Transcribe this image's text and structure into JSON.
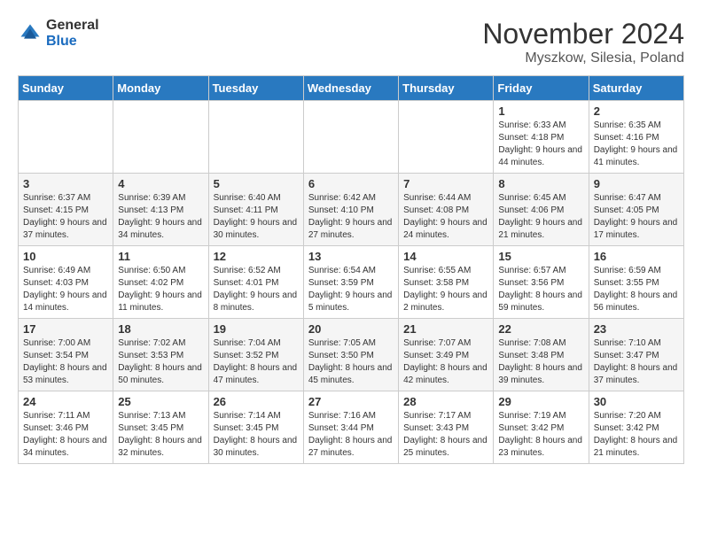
{
  "header": {
    "logo_general": "General",
    "logo_blue": "Blue",
    "month_year": "November 2024",
    "location": "Myszkow, Silesia, Poland"
  },
  "days_of_week": [
    "Sunday",
    "Monday",
    "Tuesday",
    "Wednesday",
    "Thursday",
    "Friday",
    "Saturday"
  ],
  "weeks": [
    [
      {
        "day": "",
        "info": ""
      },
      {
        "day": "",
        "info": ""
      },
      {
        "day": "",
        "info": ""
      },
      {
        "day": "",
        "info": ""
      },
      {
        "day": "",
        "info": ""
      },
      {
        "day": "1",
        "info": "Sunrise: 6:33 AM\nSunset: 4:18 PM\nDaylight: 9 hours\nand 44 minutes."
      },
      {
        "day": "2",
        "info": "Sunrise: 6:35 AM\nSunset: 4:16 PM\nDaylight: 9 hours\nand 41 minutes."
      }
    ],
    [
      {
        "day": "3",
        "info": "Sunrise: 6:37 AM\nSunset: 4:15 PM\nDaylight: 9 hours\nand 37 minutes."
      },
      {
        "day": "4",
        "info": "Sunrise: 6:39 AM\nSunset: 4:13 PM\nDaylight: 9 hours\nand 34 minutes."
      },
      {
        "day": "5",
        "info": "Sunrise: 6:40 AM\nSunset: 4:11 PM\nDaylight: 9 hours\nand 30 minutes."
      },
      {
        "day": "6",
        "info": "Sunrise: 6:42 AM\nSunset: 4:10 PM\nDaylight: 9 hours\nand 27 minutes."
      },
      {
        "day": "7",
        "info": "Sunrise: 6:44 AM\nSunset: 4:08 PM\nDaylight: 9 hours\nand 24 minutes."
      },
      {
        "day": "8",
        "info": "Sunrise: 6:45 AM\nSunset: 4:06 PM\nDaylight: 9 hours\nand 21 minutes."
      },
      {
        "day": "9",
        "info": "Sunrise: 6:47 AM\nSunset: 4:05 PM\nDaylight: 9 hours\nand 17 minutes."
      }
    ],
    [
      {
        "day": "10",
        "info": "Sunrise: 6:49 AM\nSunset: 4:03 PM\nDaylight: 9 hours\nand 14 minutes."
      },
      {
        "day": "11",
        "info": "Sunrise: 6:50 AM\nSunset: 4:02 PM\nDaylight: 9 hours\nand 11 minutes."
      },
      {
        "day": "12",
        "info": "Sunrise: 6:52 AM\nSunset: 4:01 PM\nDaylight: 9 hours\nand 8 minutes."
      },
      {
        "day": "13",
        "info": "Sunrise: 6:54 AM\nSunset: 3:59 PM\nDaylight: 9 hours\nand 5 minutes."
      },
      {
        "day": "14",
        "info": "Sunrise: 6:55 AM\nSunset: 3:58 PM\nDaylight: 9 hours\nand 2 minutes."
      },
      {
        "day": "15",
        "info": "Sunrise: 6:57 AM\nSunset: 3:56 PM\nDaylight: 8 hours\nand 59 minutes."
      },
      {
        "day": "16",
        "info": "Sunrise: 6:59 AM\nSunset: 3:55 PM\nDaylight: 8 hours\nand 56 minutes."
      }
    ],
    [
      {
        "day": "17",
        "info": "Sunrise: 7:00 AM\nSunset: 3:54 PM\nDaylight: 8 hours\nand 53 minutes."
      },
      {
        "day": "18",
        "info": "Sunrise: 7:02 AM\nSunset: 3:53 PM\nDaylight: 8 hours\nand 50 minutes."
      },
      {
        "day": "19",
        "info": "Sunrise: 7:04 AM\nSunset: 3:52 PM\nDaylight: 8 hours\nand 47 minutes."
      },
      {
        "day": "20",
        "info": "Sunrise: 7:05 AM\nSunset: 3:50 PM\nDaylight: 8 hours\nand 45 minutes."
      },
      {
        "day": "21",
        "info": "Sunrise: 7:07 AM\nSunset: 3:49 PM\nDaylight: 8 hours\nand 42 minutes."
      },
      {
        "day": "22",
        "info": "Sunrise: 7:08 AM\nSunset: 3:48 PM\nDaylight: 8 hours\nand 39 minutes."
      },
      {
        "day": "23",
        "info": "Sunrise: 7:10 AM\nSunset: 3:47 PM\nDaylight: 8 hours\nand 37 minutes."
      }
    ],
    [
      {
        "day": "24",
        "info": "Sunrise: 7:11 AM\nSunset: 3:46 PM\nDaylight: 8 hours\nand 34 minutes."
      },
      {
        "day": "25",
        "info": "Sunrise: 7:13 AM\nSunset: 3:45 PM\nDaylight: 8 hours\nand 32 minutes."
      },
      {
        "day": "26",
        "info": "Sunrise: 7:14 AM\nSunset: 3:45 PM\nDaylight: 8 hours\nand 30 minutes."
      },
      {
        "day": "27",
        "info": "Sunrise: 7:16 AM\nSunset: 3:44 PM\nDaylight: 8 hours\nand 27 minutes."
      },
      {
        "day": "28",
        "info": "Sunrise: 7:17 AM\nSunset: 3:43 PM\nDaylight: 8 hours\nand 25 minutes."
      },
      {
        "day": "29",
        "info": "Sunrise: 7:19 AM\nSunset: 3:42 PM\nDaylight: 8 hours\nand 23 minutes."
      },
      {
        "day": "30",
        "info": "Sunrise: 7:20 AM\nSunset: 3:42 PM\nDaylight: 8 hours\nand 21 minutes."
      }
    ]
  ]
}
